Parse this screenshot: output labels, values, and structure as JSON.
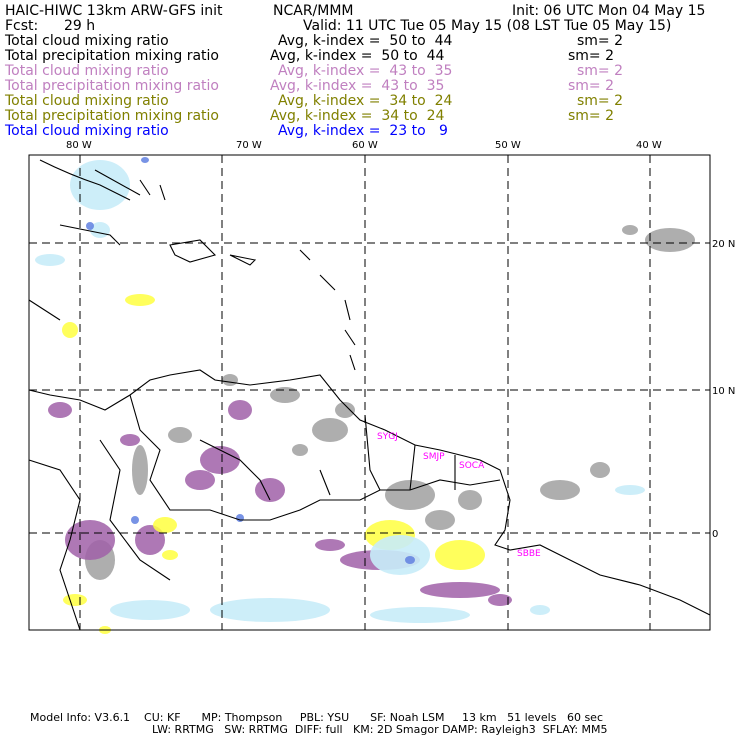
{
  "header": {
    "title": "HAIC-HIWC 13km ARW-GFS init",
    "org": "NCAR/MMM",
    "init": "Init: 06 UTC Mon 04 May 15",
    "fcst_label": "Fcst:",
    "fcst_value": "29 h",
    "valid": "Valid: 11 UTC Tue 05 May 15 (08 LST Tue 05 May 15)"
  },
  "fields": [
    {
      "name": "Total cloud mixing ratio",
      "avg": "Avg, k-index =  50 to  44",
      "sm": "sm= 2",
      "color": "#000000"
    },
    {
      "name": "Total precipitation mixing ratio",
      "avg": "Avg, k-index =  50 to  44",
      "sm": "sm= 2",
      "color": "#000000"
    },
    {
      "name": "Total cloud mixing ratio",
      "avg": "Avg, k-index =  43 to  35",
      "sm": "sm= 2",
      "color": "#c080c0"
    },
    {
      "name": "Total precipitation mixing ratio",
      "avg": "Avg, k-index =  43 to  35",
      "sm": "sm= 2",
      "color": "#c080c0"
    },
    {
      "name": "Total cloud mixing ratio",
      "avg": "Avg, k-index =  34 to  24",
      "sm": "sm= 2",
      "color": "#808000"
    },
    {
      "name": "Total precipitation mixing ratio",
      "avg": "Avg, k-index =  34 to  24",
      "sm": "sm= 2",
      "color": "#808000"
    },
    {
      "name": "Total cloud mixing ratio",
      "avg": "Avg, k-index =  23 to   9",
      "sm": "",
      "color": "#0000ff"
    }
  ],
  "map": {
    "lon_labels": [
      "80 W",
      "70 W",
      "60 W",
      "50 W",
      "40 W"
    ],
    "lat_labels": [
      "20 N",
      "10 N",
      "0"
    ],
    "stations": [
      "SYGJ",
      "SMJP",
      "SOCA",
      "SBBE"
    ],
    "colors": {
      "gray": "#a0a0a0",
      "purple": "#a060a8",
      "yellow": "#ffff40",
      "lightblue": "#c8ecf8",
      "blue": "#6080e0"
    }
  },
  "footer": {
    "line1": "Model Info: V3.6.1    CU: KF      MP: Thompson     PBL: YSU      SF: Noah LSM     13 km   51 levels   60 sec",
    "line2": "LW: RRTMG   SW: RRTMG  DIFF: full   KM: 2D Smagor DAMP: Rayleigh3  SFLAY: MM5"
  }
}
